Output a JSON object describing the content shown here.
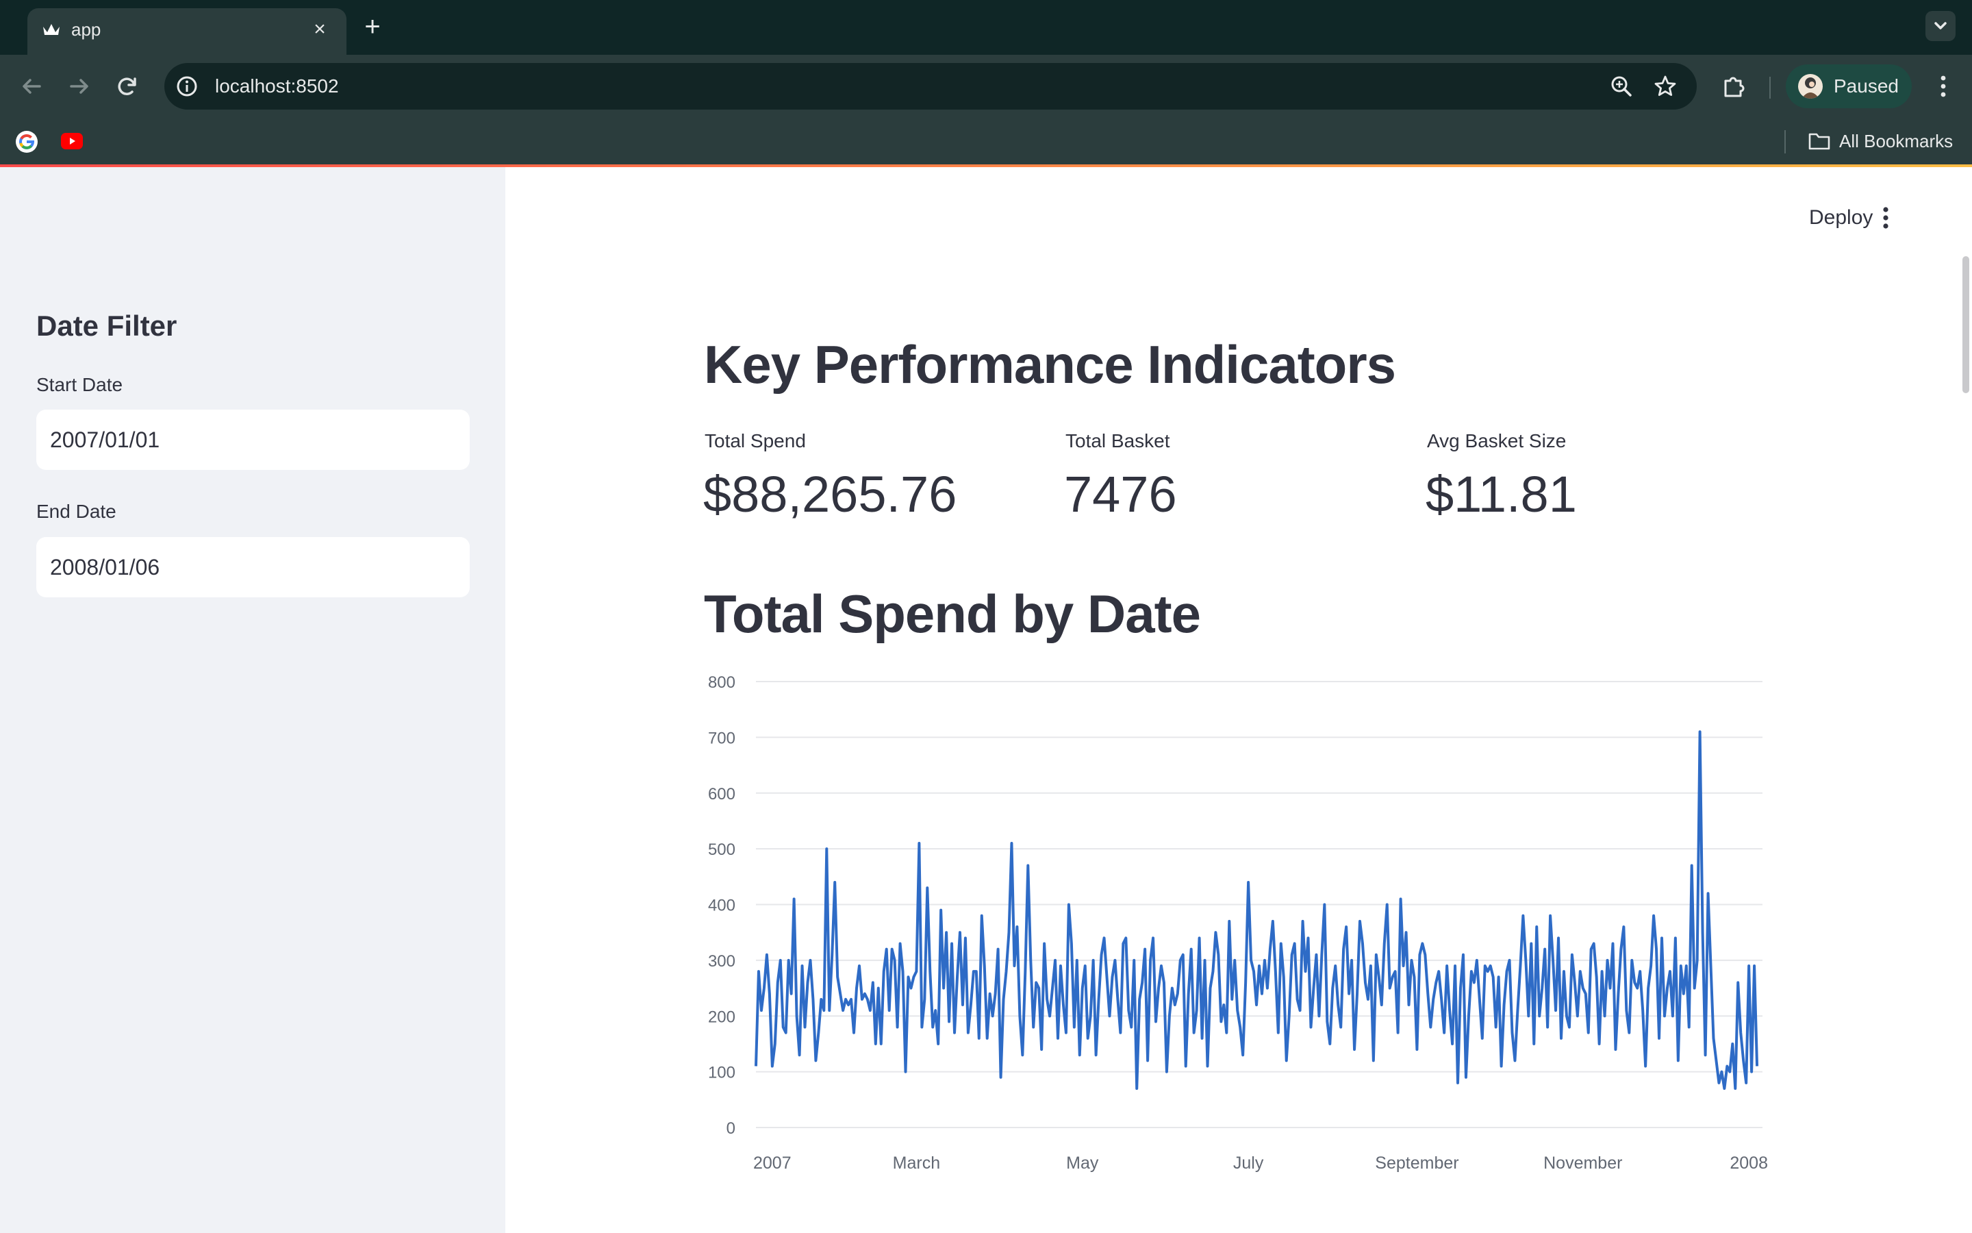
{
  "browser": {
    "tab": {
      "title": "app",
      "close_label": "×"
    },
    "new_tab_label": "+",
    "url": "localhost:8502",
    "profile_label": "Paused",
    "bookmarks_label": "All Bookmarks"
  },
  "app": {
    "deploy_label": "Deploy",
    "sidebar": {
      "title": "Date Filter",
      "start_date_label": "Start Date",
      "start_date_value": "2007/01/01",
      "end_date_label": "End Date",
      "end_date_value": "2008/01/06"
    },
    "kpi_heading": "Key Performance Indicators",
    "metrics": [
      {
        "label": "Total Spend",
        "value": "$88,265.76"
      },
      {
        "label": "Total Basket",
        "value": "7476"
      },
      {
        "label": "Avg Basket Size",
        "value": "$11.81"
      }
    ],
    "chart_heading": "Total Spend by Date"
  },
  "colors": {
    "accent": "#ff4b4b",
    "line": "#2e6bc6",
    "sidebar_bg": "#f0f2f6"
  },
  "icons": [
    "tab-favicon-icon",
    "close-icon",
    "plus-icon",
    "chevron-down-icon",
    "back-arrow-icon",
    "forward-arrow-icon",
    "reload-icon",
    "info-icon",
    "zoom-icon",
    "star-icon",
    "extensions-icon",
    "kebab-menu-icon",
    "google-icon",
    "youtube-icon",
    "folder-icon"
  ],
  "chart_data": {
    "type": "line",
    "title": "",
    "xlabel": "",
    "ylabel": "",
    "ylim": [
      0,
      800
    ],
    "yticks": [
      0,
      100,
      200,
      300,
      400,
      500,
      600,
      700,
      800
    ],
    "xtick_labels": [
      "2007",
      "March",
      "May",
      "July",
      "September",
      "November",
      "2008"
    ],
    "xlim": [
      "2007-01-01",
      "2008-01-06"
    ],
    "grid": true,
    "series": [
      {
        "start": "2007-01-01",
        "step_days": 1,
        "values": [
          110,
          280,
          210,
          250,
          310,
          240,
          110,
          150,
          260,
          300,
          180,
          170,
          300,
          240,
          410,
          200,
          130,
          290,
          180,
          260,
          300,
          230,
          120,
          170,
          230,
          210,
          500,
          210,
          310,
          440,
          270,
          240,
          210,
          230,
          220,
          230,
          170,
          250,
          290,
          230,
          240,
          230,
          210,
          260,
          150,
          250,
          150,
          280,
          320,
          210,
          320,
          300,
          180,
          330,
          280,
          100,
          270,
          250,
          270,
          280,
          510,
          180,
          230,
          430,
          280,
          180,
          210,
          150,
          390,
          250,
          350,
          190,
          330,
          170,
          270,
          350,
          220,
          340,
          170,
          220,
          280,
          280,
          160,
          380,
          290,
          160,
          240,
          200,
          240,
          320,
          90,
          230,
          280,
          350,
          510,
          290,
          360,
          200,
          130,
          280,
          470,
          300,
          180,
          260,
          250,
          140,
          330,
          230,
          200,
          250,
          300,
          160,
          290,
          220,
          170,
          400,
          330,
          180,
          300,
          130,
          250,
          290,
          160,
          200,
          300,
          130,
          230,
          310,
          340,
          270,
          200,
          270,
          300,
          230,
          170,
          330,
          340,
          210,
          180,
          300,
          70,
          230,
          260,
          320,
          120,
          300,
          340,
          190,
          250,
          290,
          260,
          100,
          200,
          250,
          220,
          240,
          300,
          310,
          110,
          240,
          320,
          170,
          210,
          340,
          160,
          300,
          110,
          250,
          280,
          350,
          310,
          190,
          220,
          170,
          370,
          230,
          300,
          210,
          180,
          130,
          260,
          440,
          300,
          280,
          220,
          290,
          240,
          300,
          250,
          320,
          370,
          280,
          170,
          330,
          270,
          120,
          200,
          310,
          330,
          230,
          210,
          370,
          280,
          340,
          180,
          250,
          310,
          200,
          310,
          400,
          190,
          150,
          250,
          290,
          220,
          180,
          320,
          360,
          240,
          300,
          140,
          240,
          370,
          330,
          260,
          230,
          290,
          120,
          310,
          270,
          220,
          330,
          400,
          250,
          270,
          280,
          170,
          410,
          290,
          350,
          220,
          300,
          270,
          140,
          310,
          330,
          310,
          240,
          180,
          230,
          260,
          280,
          230,
          170,
          290,
          210,
          150,
          290,
          80,
          250,
          310,
          90,
          200,
          280,
          260,
          300,
          230,
          160,
          290,
          280,
          290,
          270,
          180,
          270,
          110,
          220,
          280,
          300,
          170,
          120,
          210,
          290,
          380,
          300,
          200,
          330,
          150,
          360,
          200,
          250,
          320,
          180,
          380,
          300,
          210,
          340,
          160,
          280,
          200,
          180,
          310,
          260,
          200,
          280,
          250,
          240,
          170,
          320,
          330,
          270,
          150,
          280,
          200,
          300,
          250,
          330,
          140,
          240,
          320,
          360,
          210,
          170,
          300,
          260,
          250,
          280,
          210,
          110,
          250,
          290,
          380,
          320,
          160,
          340,
          200,
          250,
          280,
          200,
          340,
          120,
          290,
          240,
          290,
          180,
          470,
          250,
          300,
          710,
          350,
          130,
          420,
          290,
          160,
          120,
          80,
          100,
          70,
          110,
          100,
          150,
          70,
          260,
          170,
          120,
          80,
          290,
          100,
          290,
          110
        ]
      }
    ]
  }
}
